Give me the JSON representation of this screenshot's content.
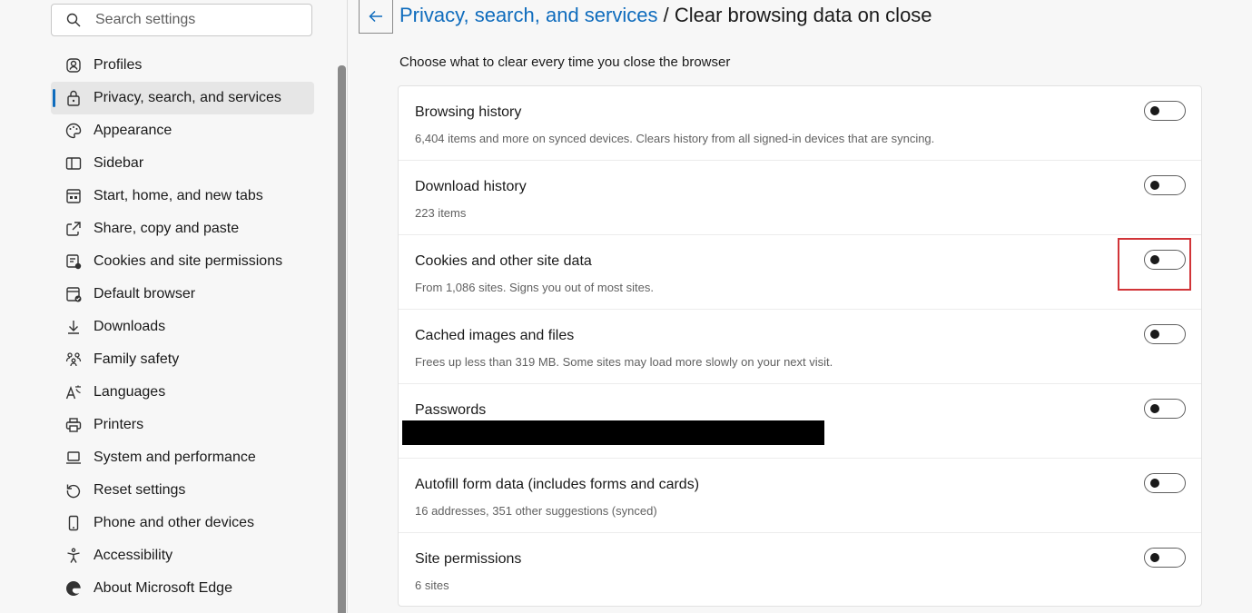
{
  "sidebar": {
    "search_placeholder": "Search settings",
    "items": [
      {
        "label": "Profiles",
        "icon": "profile-icon"
      },
      {
        "label": "Privacy, search, and services",
        "icon": "lock-icon",
        "active": true
      },
      {
        "label": "Appearance",
        "icon": "palette-icon"
      },
      {
        "label": "Sidebar",
        "icon": "sidebar-icon"
      },
      {
        "label": "Start, home, and new tabs",
        "icon": "home-tabs-icon"
      },
      {
        "label": "Share, copy and paste",
        "icon": "share-icon"
      },
      {
        "label": "Cookies and site permissions",
        "icon": "cookies-icon"
      },
      {
        "label": "Default browser",
        "icon": "default-browser-icon"
      },
      {
        "label": "Downloads",
        "icon": "download-icon"
      },
      {
        "label": "Family safety",
        "icon": "family-icon"
      },
      {
        "label": "Languages",
        "icon": "languages-icon"
      },
      {
        "label": "Printers",
        "icon": "printer-icon"
      },
      {
        "label": "System and performance",
        "icon": "laptop-icon"
      },
      {
        "label": "Reset settings",
        "icon": "reset-icon"
      },
      {
        "label": "Phone and other devices",
        "icon": "phone-icon"
      },
      {
        "label": "Accessibility",
        "icon": "accessibility-icon"
      },
      {
        "label": "About Microsoft Edge",
        "icon": "edge-logo-icon"
      }
    ]
  },
  "header": {
    "breadcrumb_link": "Privacy, search, and services",
    "separator": " / ",
    "title": "Clear browsing data on close",
    "subtitle": "Choose what to clear every time you close the browser"
  },
  "options": [
    {
      "title": "Browsing history",
      "desc": "6,404 items and more on synced devices. Clears history from all signed-in devices that are syncing.",
      "on": false
    },
    {
      "title": "Download history",
      "desc": "223 items",
      "on": false
    },
    {
      "title": "Cookies and other site data",
      "desc": "From 1,086 sites. Signs you out of most sites.",
      "on": false,
      "highlighted": true
    },
    {
      "title": "Cached images and files",
      "desc": "Frees up less than 319 MB. Some sites may load more slowly on your next visit.",
      "on": false
    },
    {
      "title": "Passwords",
      "desc": "",
      "on": false,
      "redacted": true
    },
    {
      "title": "Autofill form data (includes forms and cards)",
      "desc": "16 addresses, 351 other suggestions (synced)",
      "on": false
    },
    {
      "title": "Site permissions",
      "desc": "6 sites",
      "on": false
    }
  ],
  "colors": {
    "accent": "#0f6cbd",
    "highlight": "#d13438"
  }
}
